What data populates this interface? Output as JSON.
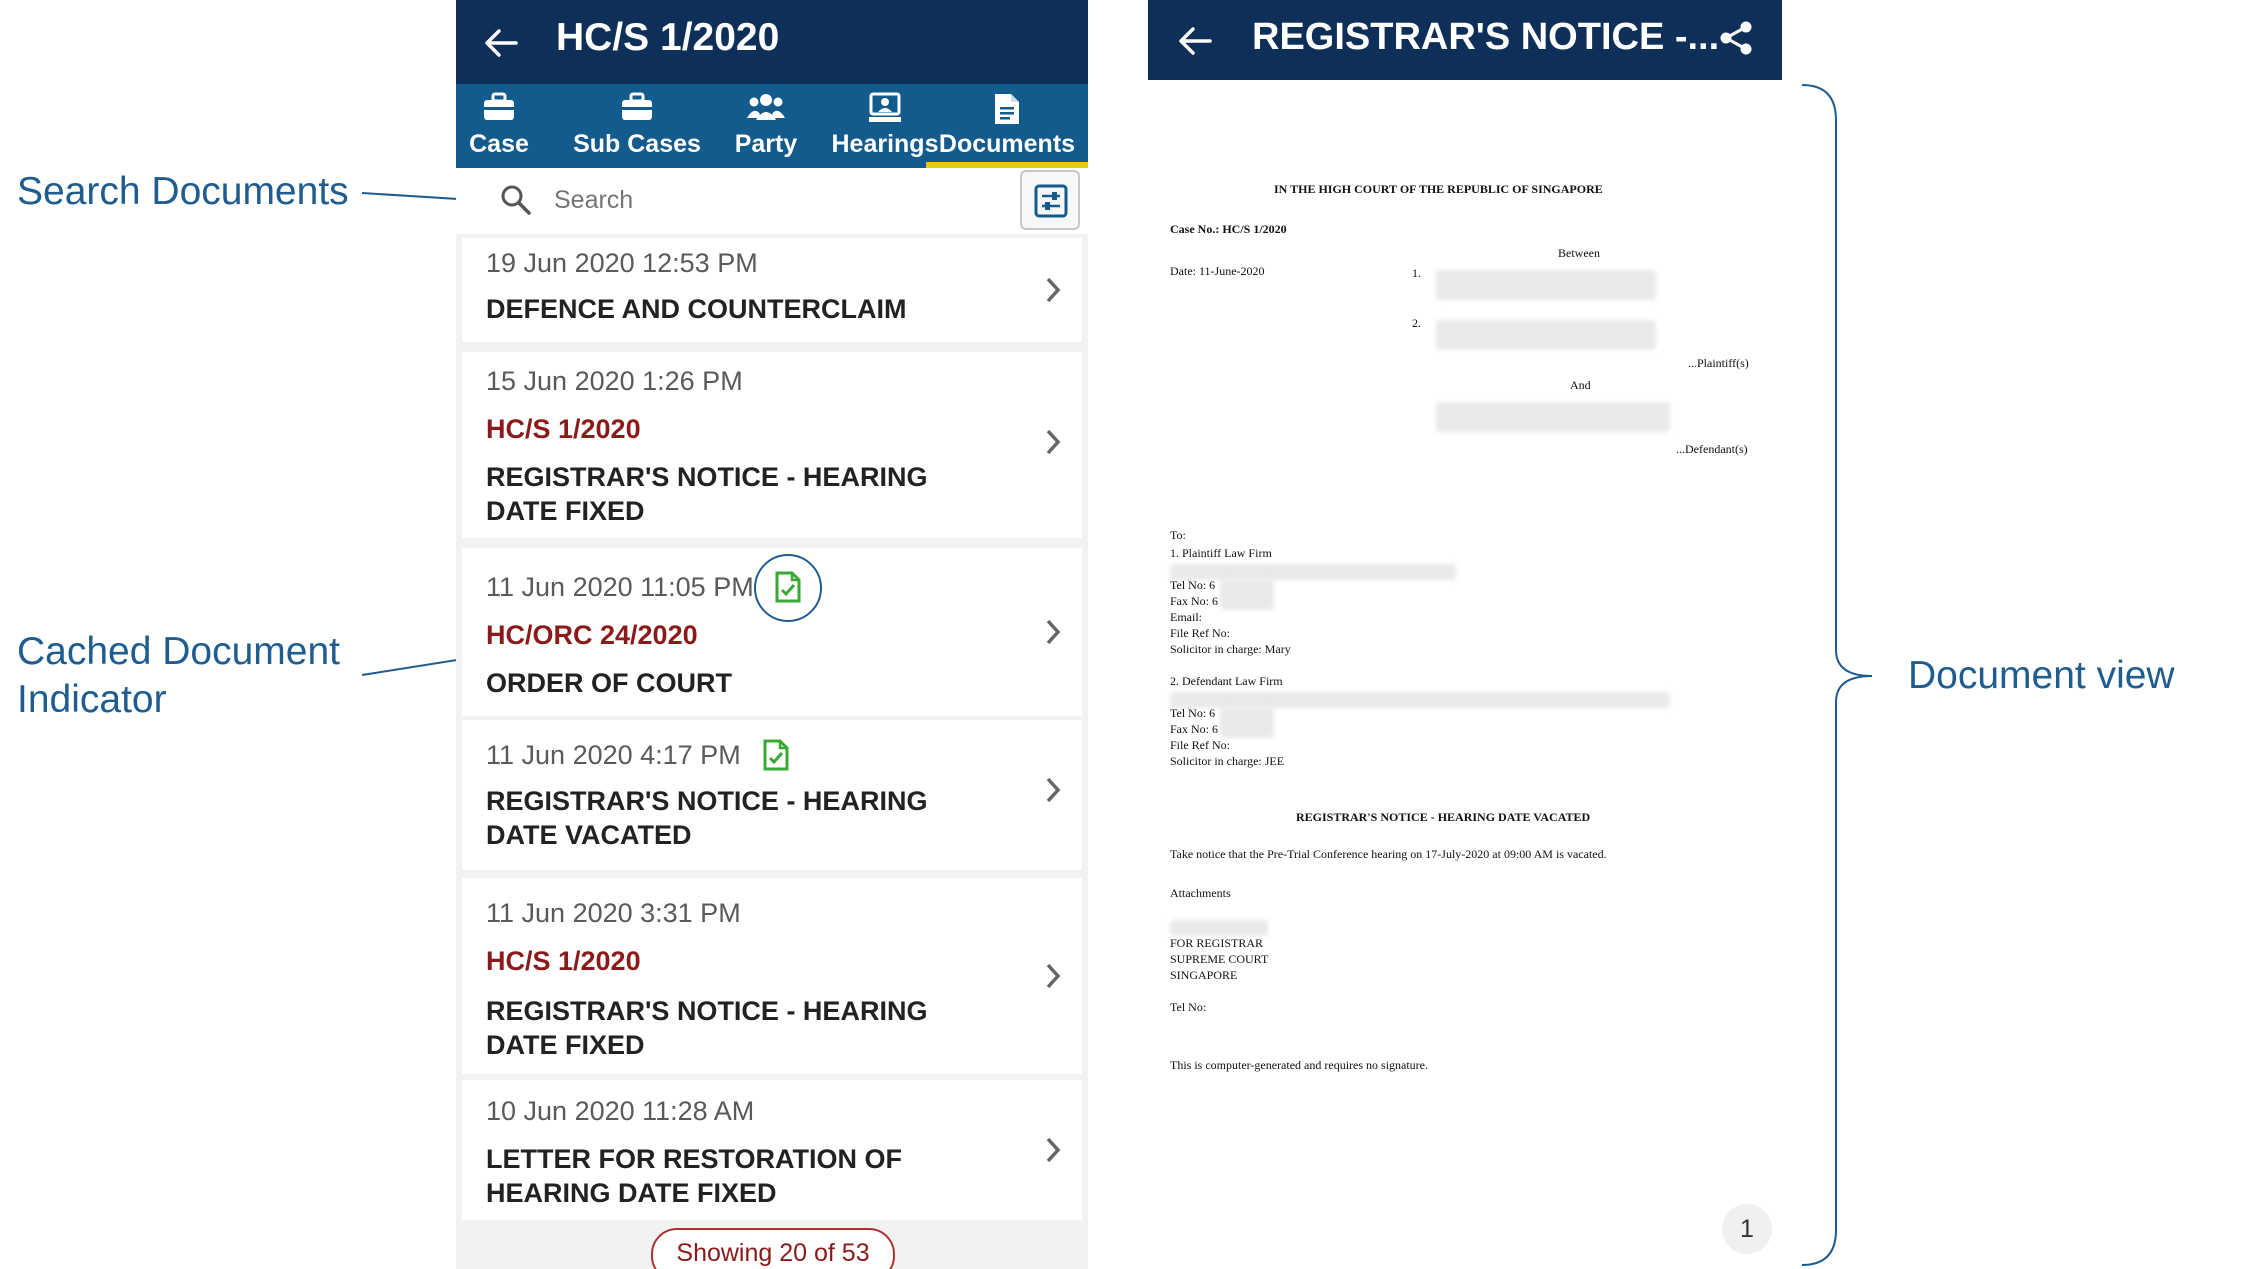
{
  "annotations": {
    "search_documents": "Search Documents",
    "cached_indicator_line1": "Cached Document",
    "cached_indicator_line2": "Indicator",
    "document_view": "Document view"
  },
  "left_screen": {
    "header_title": "HC/S 1/2020",
    "tabs": [
      {
        "label": "Case",
        "icon": "briefcase-icon"
      },
      {
        "label": "Sub Cases",
        "icon": "briefcase-icon"
      },
      {
        "label": "Party",
        "icon": "people-icon"
      },
      {
        "label": "Hearings",
        "icon": "judge-icon"
      },
      {
        "label": "Documents",
        "icon": "document-icon",
        "active": true
      }
    ],
    "search_placeholder": "Search",
    "documents": [
      {
        "date": "19 Jun 2020 12:53 PM",
        "case": "",
        "title": "DEFENCE AND COUNTERCLAIM",
        "cached": false
      },
      {
        "date": "15 Jun 2020 1:26 PM",
        "case": "HC/S 1/2020",
        "title": "REGISTRAR'S NOTICE - HEARING DATE FIXED",
        "cached": false
      },
      {
        "date": "11 Jun 2020 11:05 PM",
        "case": "HC/ORC 24/2020",
        "title": "ORDER OF COURT",
        "cached": true
      },
      {
        "date": "11 Jun 2020 4:17 PM",
        "case": "",
        "title": "REGISTRAR'S NOTICE - HEARING DATE VACATED",
        "cached": true
      },
      {
        "date": "11 Jun 2020 3:31 PM",
        "case": "HC/S 1/2020",
        "title": "REGISTRAR'S NOTICE - HEARING DATE FIXED",
        "cached": false
      },
      {
        "date": "10 Jun 2020 11:28 AM",
        "case": "",
        "title": "LETTER FOR RESTORATION OF HEARING DATE FIXED",
        "cached": false
      }
    ],
    "showing": "Showing 20 of 53"
  },
  "right_screen": {
    "header_title": "REGISTRAR'S NOTICE -...",
    "page_number": "1",
    "doc": {
      "court": "IN THE HIGH COURT OF THE REPUBLIC OF SINGAPORE",
      "case_no": "Case No.: HC/S 1/2020",
      "between": "Between",
      "date": "Date: 11-June-2020",
      "n1": "1.",
      "n2": "2.",
      "plaintiffs": "...Plaintiff(s)",
      "and": "And",
      "defendants": "...Defendant(s)",
      "to": "To:",
      "pl_firm": "1.  Plaintiff Law Firm",
      "pl_tel": "Tel No: 6",
      "pl_fax": "Fax No: 6",
      "pl_email": "Email:",
      "pl_ref": "File Ref No:",
      "pl_sol": "Solicitor in charge: Mary",
      "df_firm": "2.  Defendant Law Firm",
      "df_tel": "Tel No: 6",
      "df_fax": "Fax No: 6",
      "df_ref": "File Ref No:",
      "df_sol": "Solicitor in charge: JEE",
      "heading": "REGISTRAR'S NOTICE - HEARING DATE VACATED",
      "body": "Take notice that the Pre-Trial Conference hearing on 17-July-2020 at 09:00 AM is vacated.",
      "attachments": "Attachments",
      "for_registrar": "FOR REGISTRAR",
      "supreme_court": "SUPREME COURT",
      "singapore": "SINGAPORE",
      "tel": "Tel No:",
      "footer": "This is computer-generated and requires no signature."
    }
  }
}
